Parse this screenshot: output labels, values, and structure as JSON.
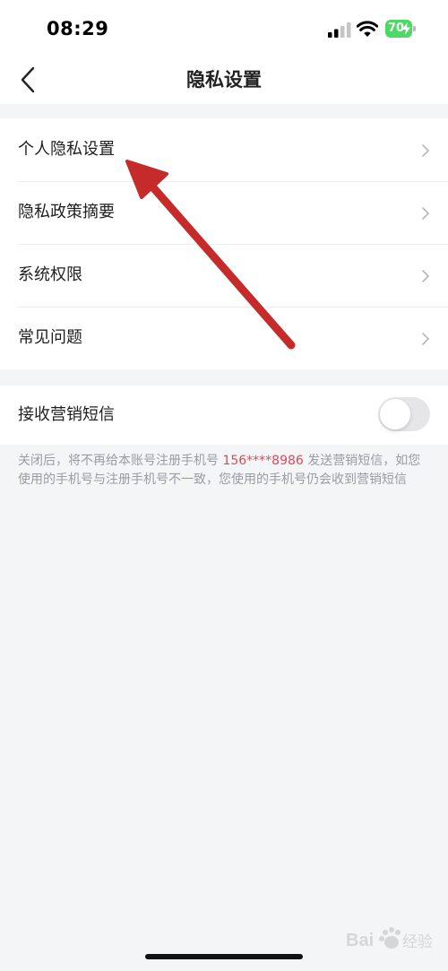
{
  "status_bar": {
    "time": "08:29",
    "battery_level": "70",
    "icons": [
      "signal-icon",
      "wifi-icon",
      "battery-icon",
      "bolt-icon"
    ]
  },
  "nav": {
    "title": "隐私设置",
    "back_icon": "chevron-left-icon"
  },
  "menu": {
    "items": [
      {
        "label": "个人隐私设置"
      },
      {
        "label": "隐私政策摘要"
      },
      {
        "label": "系统权限"
      },
      {
        "label": "常见问题"
      }
    ]
  },
  "marketing": {
    "label": "接收营销短信",
    "enabled": false
  },
  "note": {
    "before": "关闭后，将不再给本账号注册手机号 ",
    "phone": "156****8986",
    "after": " 发送营销短信，如您使用的手机号与注册手机号不一致，您使用的手机号仍会收到营销短信"
  },
  "colors": {
    "accent_red": "#d94b5c",
    "arrow_red": "#c62b2b",
    "battery_green": "#4cd964",
    "page_bg": "#f4f5f7"
  },
  "watermark": {
    "text": "Bai 经验"
  }
}
